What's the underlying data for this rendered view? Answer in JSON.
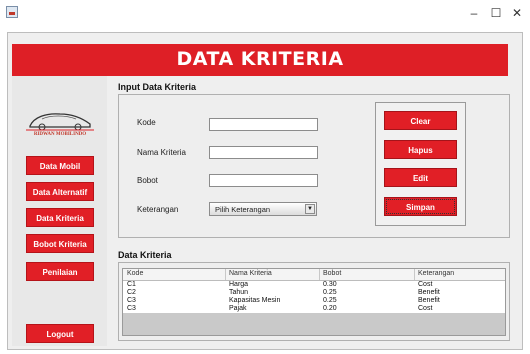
{
  "window": {
    "minimize_glyph": "–",
    "maximize_glyph": "☐",
    "close_glyph": "✕"
  },
  "header": {
    "title": "DATA KRITERIA"
  },
  "logo": {
    "text": "RIDWAN MOBILINDO"
  },
  "sidebar": {
    "items": [
      {
        "label": "Data Mobil"
      },
      {
        "label": "Data Alternatif"
      },
      {
        "label": "Data Kriteria"
      },
      {
        "label": "Bobot Kriteria"
      },
      {
        "label": "Penilaian"
      }
    ],
    "logout": "Logout"
  },
  "form": {
    "section_title": "Input Data Kriteria",
    "kode_label": "Kode",
    "nama_label": "Nama Kriteria",
    "bobot_label": "Bobot",
    "keterangan_label": "Keterangan",
    "keterangan_value": "Pilih Keterangan",
    "kode_value": "",
    "nama_value": "",
    "bobot_value": ""
  },
  "actions": {
    "clear": "Clear",
    "hapus": "Hapus",
    "edit": "Edit",
    "simpan": "Simpan"
  },
  "table": {
    "section_title": "Data Kriteria",
    "columns": [
      "Kode",
      "Nama Kriteria",
      "Bobot",
      "Keterangan"
    ],
    "rows": [
      [
        "C1",
        "Harga",
        "0.30",
        "Cost"
      ],
      [
        "C2",
        "Tahun",
        "0.25",
        "Benefit"
      ],
      [
        "C3",
        "Kapasitas Mesin",
        "0.25",
        "Benefit"
      ],
      [
        "C3",
        "Pajak",
        "0.20",
        "Cost"
      ]
    ]
  },
  "colors": {
    "accent_red": "#de1f26",
    "panel_bg": "#eeeeee"
  }
}
